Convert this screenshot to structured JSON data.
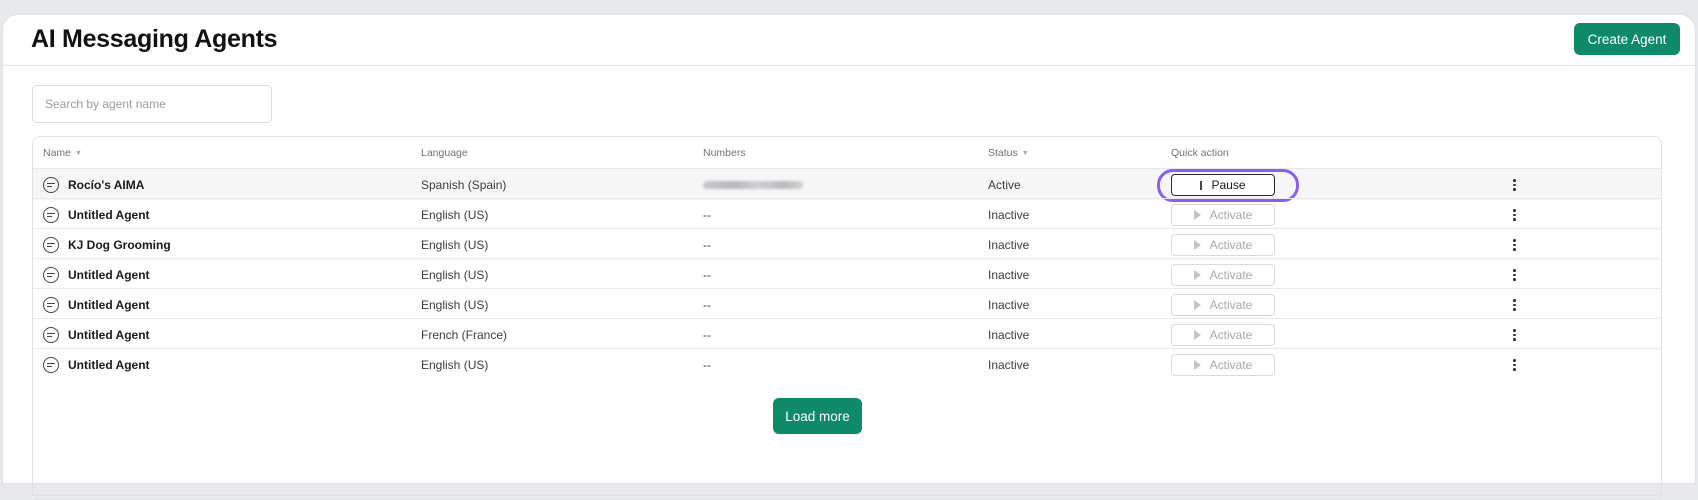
{
  "header": {
    "title": "AI Messaging Agents",
    "create_label": "Create Agent"
  },
  "search": {
    "placeholder": "Search by agent name"
  },
  "table": {
    "columns": [
      "Name",
      "Language",
      "Numbers",
      "Status",
      "Quick action"
    ],
    "rows": [
      {
        "name": "Rocío's AIMA",
        "language": "Spanish (Spain)",
        "numbers": "",
        "status": "Active",
        "action": "Pause"
      },
      {
        "name": "Untitled Agent",
        "language": "English (US)",
        "numbers": "--",
        "status": "Inactive",
        "action": "Activate"
      },
      {
        "name": "KJ Dog Grooming",
        "language": "English (US)",
        "numbers": "--",
        "status": "Inactive",
        "action": "Activate"
      },
      {
        "name": "Untitled Agent",
        "language": "English (US)",
        "numbers": "--",
        "status": "Inactive",
        "action": "Activate"
      },
      {
        "name": "Untitled Agent",
        "language": "English (US)",
        "numbers": "--",
        "status": "Inactive",
        "action": "Activate"
      },
      {
        "name": "Untitled Agent",
        "language": "French (France)",
        "numbers": "--",
        "status": "Inactive",
        "action": "Activate"
      },
      {
        "name": "Untitled Agent",
        "language": "English (US)",
        "numbers": "--",
        "status": "Inactive",
        "action": "Activate"
      }
    ]
  },
  "footer": {
    "load_more_label": "Load more"
  },
  "icons": {
    "row_icon": "chat-bubble-icon",
    "pause": "pause-icon",
    "activate": "play-icon",
    "row_menu": "kebab-menu-icon",
    "sort": "sort-caret-icon"
  },
  "colors": {
    "primary_button": "#0e8a68",
    "highlight_ring": "#8b5cf6",
    "page_background": "#e8e9ec"
  }
}
